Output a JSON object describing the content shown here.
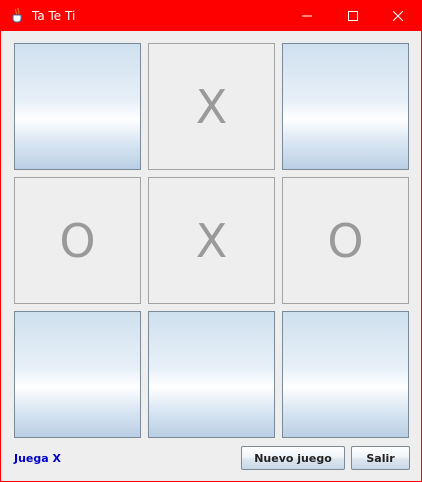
{
  "window": {
    "title": "Ta Te Ti",
    "titlebar_color": "#ff0000",
    "icons": [
      "java-cup-icon",
      "minimize-icon",
      "maximize-icon",
      "close-icon"
    ]
  },
  "board": {
    "cells": [
      {
        "mark": ""
      },
      {
        "mark": "X"
      },
      {
        "mark": ""
      },
      {
        "mark": "O"
      },
      {
        "mark": "X"
      },
      {
        "mark": "O"
      },
      {
        "mark": ""
      },
      {
        "mark": ""
      },
      {
        "mark": ""
      }
    ],
    "mark_color": "#9a9a9a"
  },
  "footer": {
    "status": "Juega X",
    "status_color": "#0000cc",
    "new_game_label": "Nuevo juego",
    "exit_label": "Salir"
  }
}
